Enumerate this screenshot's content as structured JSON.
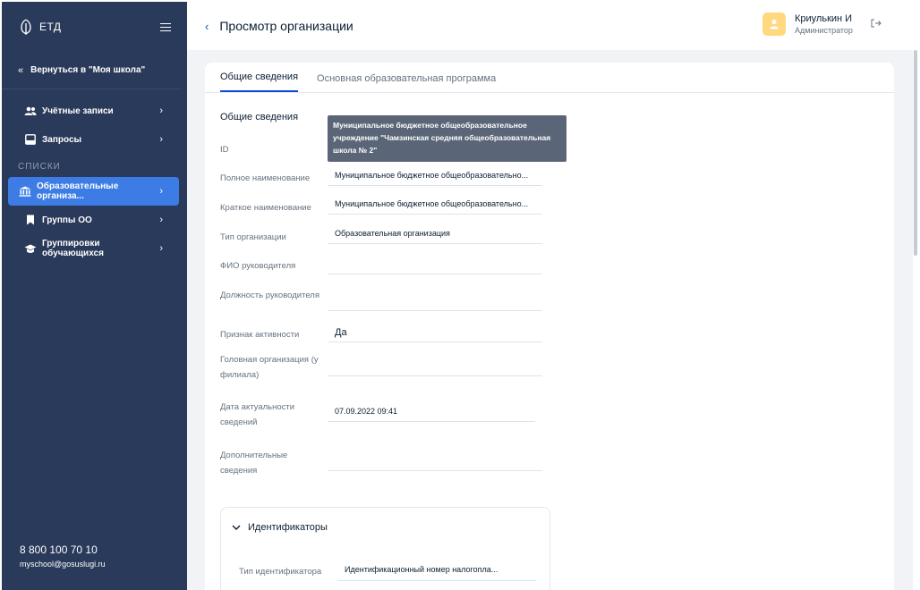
{
  "sidebar": {
    "logo_text": "ЕТД",
    "back_label": "Вернуться в \"Моя школа\"",
    "items": [
      {
        "label": "Учётные записи",
        "icon": "users-icon"
      },
      {
        "label": "Запросы",
        "icon": "inbox-icon"
      }
    ],
    "section_title": "СПИСКИ",
    "list_items": [
      {
        "label": "Образовательные организа...",
        "icon": "institution-icon",
        "active": true
      },
      {
        "label": "Группы ОО",
        "icon": "bookmark-icon"
      },
      {
        "label": "Группировки обучающихся",
        "icon": "graduation-cap-icon"
      }
    ],
    "phone": "8 800 100 70 10",
    "email": "myschool@gosuslugi.ru",
    "bg_color": "#2a3a5a",
    "active_color": "#3c7ce4"
  },
  "header": {
    "title": "Просмотр организации",
    "user_name": "Криулькин И",
    "user_role": "Администратор"
  },
  "tabs": [
    {
      "label": "Общие сведения",
      "active": true
    },
    {
      "label": "Основная образовательная программа",
      "active": false
    }
  ],
  "general": {
    "section_title": "Общие сведения",
    "fields": [
      {
        "label": "ID",
        "value": ""
      },
      {
        "label": "Полное наименование",
        "value": "Муниципальное бюджетное общеобразовательно..."
      },
      {
        "label": "Краткое наименование",
        "value": "Муниципальное бюджетное общеобразовательно..."
      },
      {
        "label": "Тип организации",
        "value": "Образовательная организация"
      },
      {
        "label": "ФИО руководителя",
        "value": ""
      },
      {
        "label": "Должность руководителя",
        "value": ""
      },
      {
        "label": "Признак активности",
        "value": "Да"
      },
      {
        "label": "Головная организация (у филиала)",
        "value": ""
      },
      {
        "label": "Дата актуальности сведений",
        "value": "07.09.2022 09:41"
      },
      {
        "label": "Дополнительные сведения",
        "value": ""
      }
    ]
  },
  "tooltip": {
    "text": "Муниципальное бюджетное общеобразовательное учреждение \"Чамзинская средняя общеобразовательная школа № 2\""
  },
  "identifiers": {
    "title": "Идентификаторы",
    "type_label": "Тип идентификатора",
    "type_value": "Идентификационный номер налогопла..."
  }
}
